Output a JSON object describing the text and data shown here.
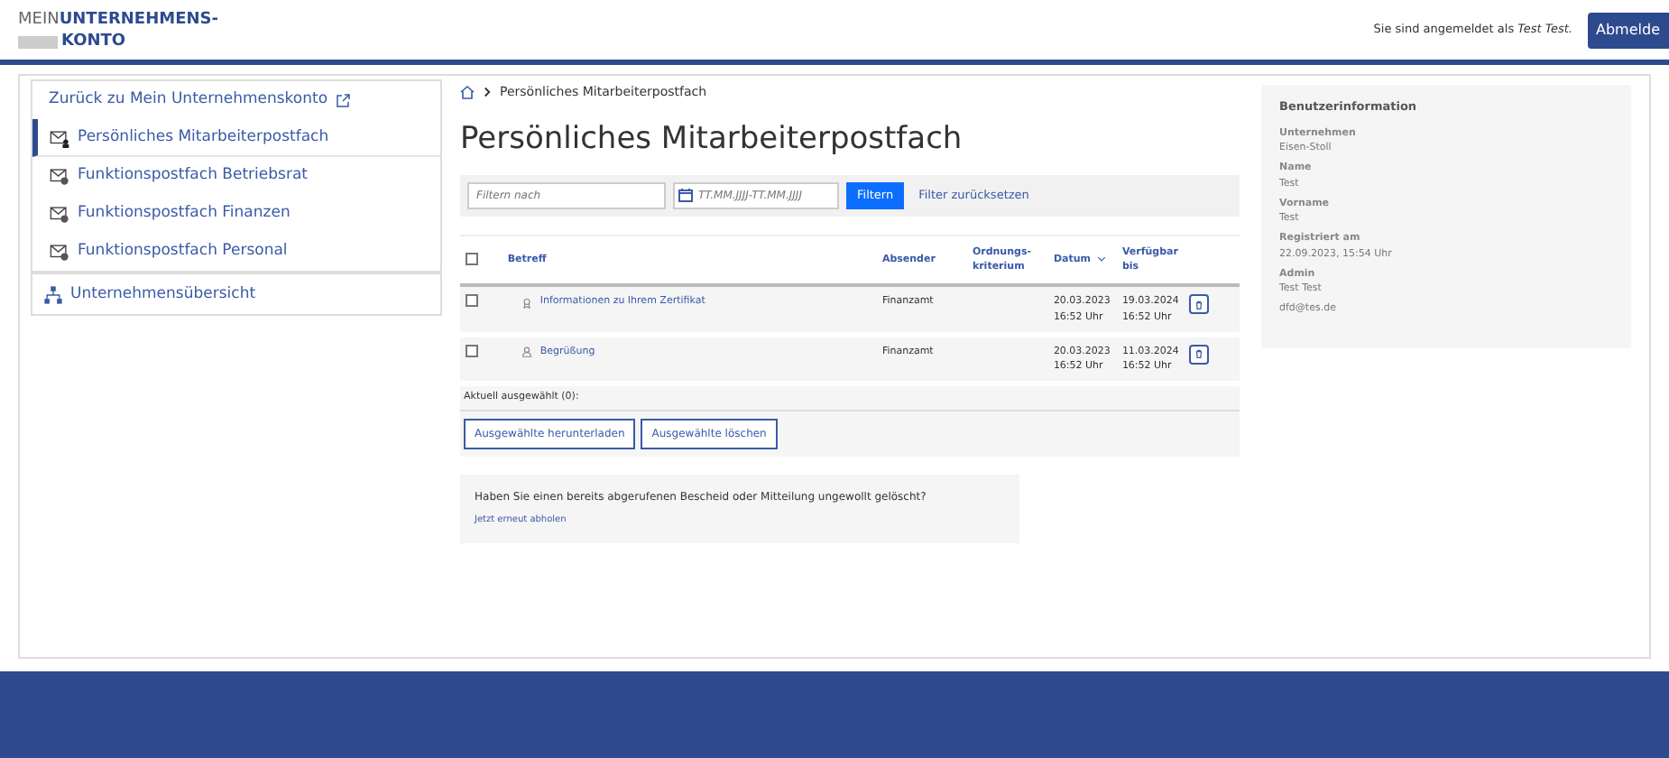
{
  "header": {
    "logo_light": "MEIN",
    "logo_bold_1": "UNTERNEHMENS-",
    "logo_bold_2": "KONTO",
    "login_text": "Sie sind angemeldet als",
    "login_user": "Test Test.",
    "logout": "Abmelde"
  },
  "sidebar": {
    "back_link": "Zurück zu Mein Unternehmenskonto",
    "items": [
      {
        "label": "Persönliches Mitarbeiterpostfach",
        "kind": "personal",
        "selected": true
      },
      {
        "label": "Funktionspostfach Betriebsrat",
        "kind": "function",
        "selected": false
      },
      {
        "label": "Funktionspostfach Finanzen",
        "kind": "function",
        "selected": false
      },
      {
        "label": "Funktionspostfach Personal",
        "kind": "function",
        "selected": false
      }
    ],
    "overview": "Unternehmensübersicht"
  },
  "breadcrumb": [
    "Persönliches Mitarbeiterpostfach"
  ],
  "title": "Persönliches Mitarbeiterpostfach",
  "filter": {
    "search_placeholder": "Filtern nach",
    "date_placeholder": "TT.MM.JJJJ-TT.MM.JJJJ",
    "apply": "Filtern",
    "reset": "Filter zurücksetzen"
  },
  "table": {
    "select_all_checked": false,
    "columns": [
      {
        "label": "Betreff",
        "sorted": false
      },
      {
        "label": "Absender",
        "sorted": false
      },
      {
        "label": "Ordnungs-kriterium",
        "sorted": false
      },
      {
        "label": "Datum",
        "sorted": true
      },
      {
        "label": "Verfügbar bis",
        "sorted": false
      }
    ],
    "rows": [
      {
        "checked": false,
        "kind": "certificate",
        "subject": "Informationen zu Ihrem Zertifikat",
        "sender": "Finanzamt",
        "date": "20.03.2023",
        "date_time": "16:52 Uhr",
        "until": "19.03.2024",
        "until_time": "16:52 Uhr"
      },
      {
        "checked": false,
        "kind": "person",
        "subject": "Begrüßung",
        "sender": "Finanzamt",
        "date": "20.03.2023",
        "date_time": "16:52 Uhr",
        "until": "11.03.2024",
        "until_time": "16:52 Uhr"
      }
    ],
    "selected_count": "Aktuell ausgewählt (0):",
    "actions": [
      "Ausgewählte herunterladen",
      "Ausgewählte löschen"
    ]
  },
  "restore": {
    "text": "Haben Sie einen bereits abgerufenen Bescheid oder Mitteilung ungewollt gelöscht?",
    "link": "Jetzt erneut abholen"
  },
  "user_info": {
    "title": "Benutzerinformation",
    "fields": [
      {
        "label": "Unternehmen",
        "value": "Eisen-Stoll"
      },
      {
        "label": "Name",
        "value": "Test"
      },
      {
        "label": "Vorname",
        "value": "Test"
      },
      {
        "label": "Registriert am",
        "value": "22.09.2023, 15:54 Uhr"
      },
      {
        "label": "Admin",
        "value": "Test Test"
      },
      {
        "value": "dfd@tes.de"
      }
    ]
  }
}
